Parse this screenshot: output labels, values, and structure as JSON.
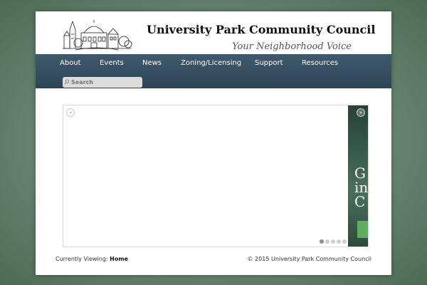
{
  "header": {
    "title": "University Park Community Council",
    "tagline": "Your Neighborhood Voice"
  },
  "nav": {
    "items": [
      {
        "label": "About"
      },
      {
        "label": "Events"
      },
      {
        "label": "News"
      },
      {
        "label": "Zoning/Licensing"
      },
      {
        "label": "Support"
      },
      {
        "label": "Resources"
      }
    ]
  },
  "search": {
    "placeholder": "Search",
    "icon": "search-icon"
  },
  "slider": {
    "prev_icon": "chevron-left-icon",
    "next_icon": "chevron-right-icon",
    "prev_glyph": "«",
    "next_glyph": "»",
    "slide_text": "G\nin\nC",
    "dots_count": 5,
    "active_dot": 1
  },
  "footer": {
    "viewing_label": "Currently Viewing:",
    "viewing_value": "Home",
    "copyright": "© 2015 University Park Community Council"
  },
  "colors": {
    "nav_bg": "#2c4556",
    "background": "#6f8c78"
  }
}
